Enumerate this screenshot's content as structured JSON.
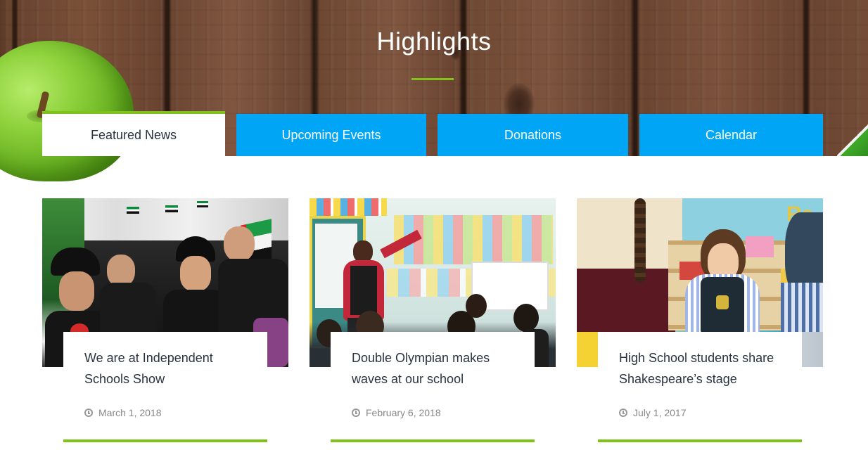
{
  "section": {
    "title": "Highlights"
  },
  "tabs": [
    {
      "label": "Featured News",
      "active": true
    },
    {
      "label": "Upcoming Events",
      "active": false
    },
    {
      "label": "Donations",
      "active": false
    },
    {
      "label": "Calendar",
      "active": false
    }
  ],
  "news": [
    {
      "headline": "We are at Independent Schools Show",
      "date": "March 1, 2018",
      "icon": "clock-icon"
    },
    {
      "headline": "Double Olympian makes waves at our school",
      "date": "February 6, 2018",
      "icon": "clock-icon"
    },
    {
      "headline": "High School students share Shakespeare’s stage",
      "date": "July 1, 2017",
      "icon": "clock-icon"
    }
  ],
  "colors": {
    "accent_green": "#80c21c",
    "tab_blue": "#00a6f5",
    "heading_text": "#2a3340",
    "date_text": "#888888"
  }
}
